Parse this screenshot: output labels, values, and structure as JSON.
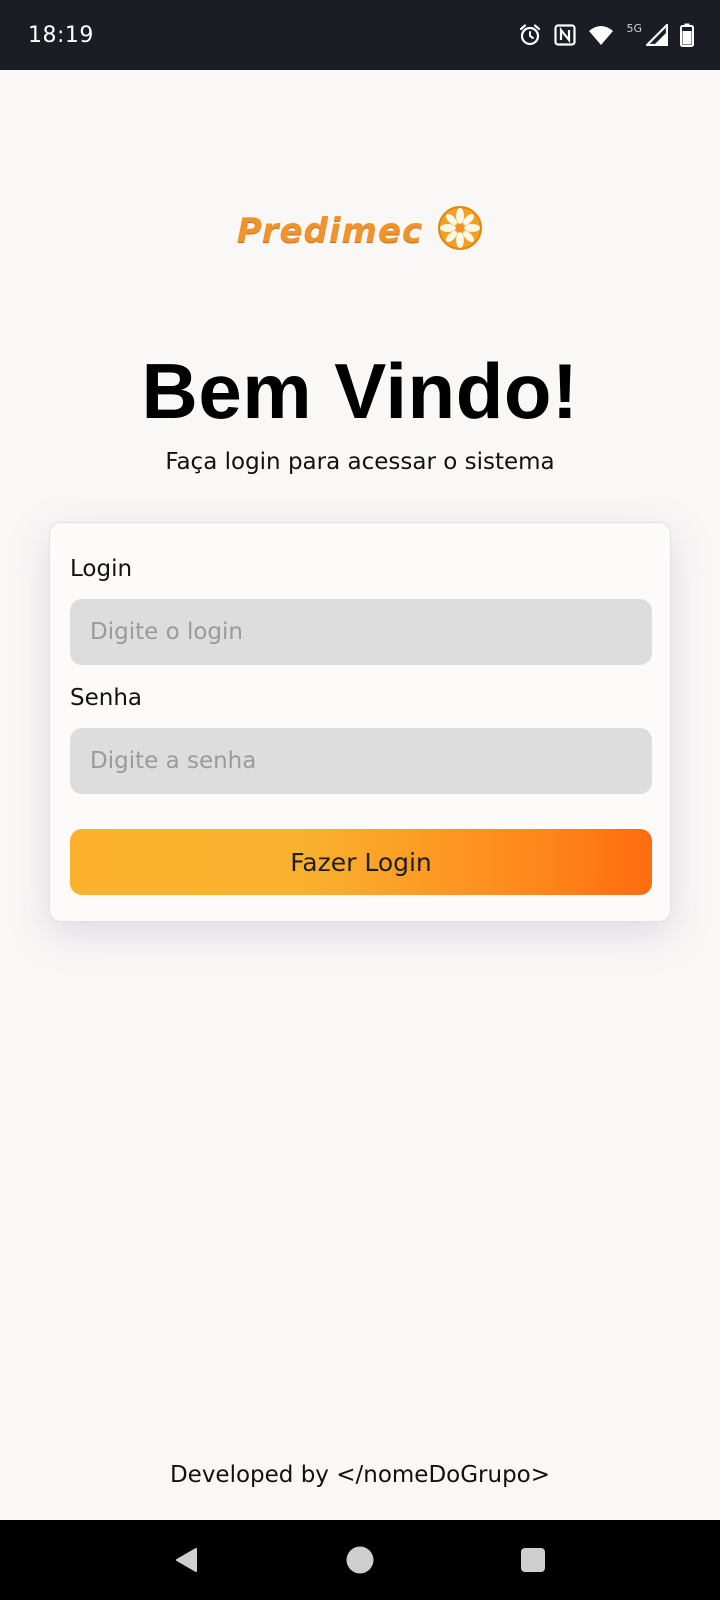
{
  "status_bar": {
    "time": "18:19",
    "network_label": "5G",
    "icons": [
      "alarm-icon",
      "nfc-icon",
      "wifi-icon",
      "cellular-signal-icon",
      "battery-icon"
    ]
  },
  "logo": {
    "text": "Predimec",
    "icon": "gear-flower-icon",
    "color": "#f0932c"
  },
  "welcome": {
    "title": "Bem Vindo!",
    "subtitle": "Faça login para acessar o sistema"
  },
  "form": {
    "login_label": "Login",
    "login_placeholder": "Digite o login",
    "login_value": "",
    "password_label": "Senha",
    "password_placeholder": "Digite a senha",
    "password_value": "",
    "submit_label": "Fazer Login",
    "button_gradient": [
      "#fbb12e",
      "#ff6c0e"
    ]
  },
  "footer": {
    "credit": "Developed by </nomeDoGrupo>"
  },
  "nav_bar": {
    "icons": [
      "back-icon",
      "home-icon",
      "recents-icon"
    ]
  }
}
